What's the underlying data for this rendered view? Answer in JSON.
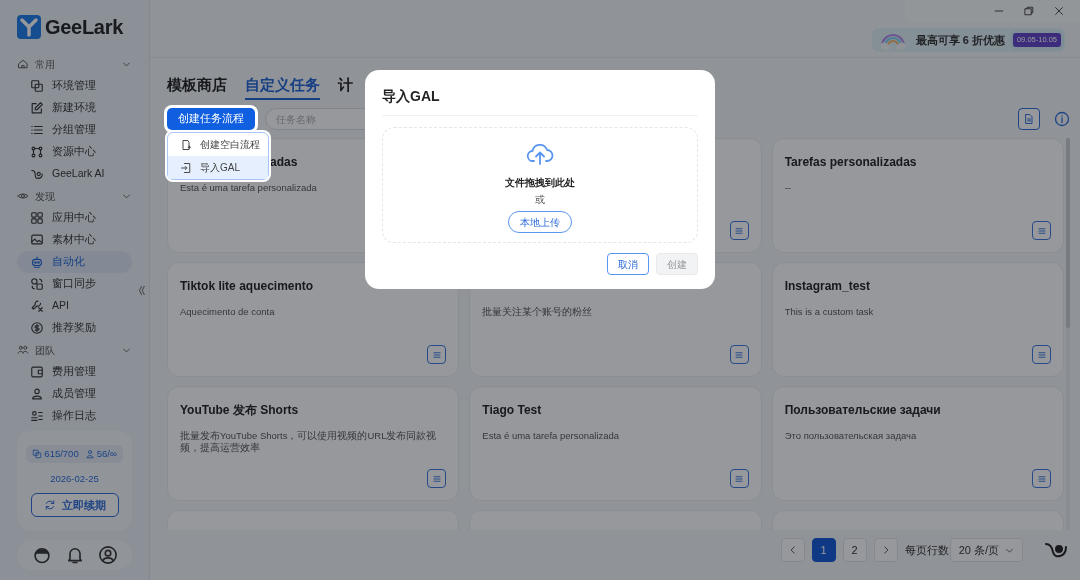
{
  "sidebar": {
    "logo": "GeeLark",
    "groups": [
      {
        "label": "常用",
        "expanded": true,
        "items": [
          {
            "label": "环境管理",
            "selected": false
          },
          {
            "label": "新建环境",
            "selected": false
          },
          {
            "label": "分组管理",
            "selected": false
          },
          {
            "label": "资源中心",
            "selected": false
          },
          {
            "label": "GeeLark AI",
            "selected": false
          }
        ]
      },
      {
        "label": "发现",
        "expanded": true,
        "items": [
          {
            "label": "应用中心",
            "selected": false
          },
          {
            "label": "素材中心",
            "selected": false
          },
          {
            "label": "自动化",
            "selected": true
          },
          {
            "label": "窗口同步",
            "selected": false
          },
          {
            "label": "API",
            "selected": false
          },
          {
            "label": "推荐奖励",
            "selected": false
          }
        ]
      },
      {
        "label": "团队",
        "expanded": true,
        "items": [
          {
            "label": "费用管理",
            "selected": false
          },
          {
            "label": "成员管理",
            "selected": false
          },
          {
            "label": "操作日志",
            "selected": false
          }
        ]
      }
    ],
    "plan": {
      "devices": "615/700",
      "members": "56/∞",
      "expiry": "2026-02-25",
      "renew_button": "立即续期"
    }
  },
  "promo": {
    "text": "最高可享 6 折优惠",
    "dates": "09.05-10.05"
  },
  "tabs": [
    {
      "label": "模板商店",
      "selected": false
    },
    {
      "label": "自定义任务",
      "selected": true
    },
    {
      "label": "计",
      "selected": false
    }
  ],
  "create_button": {
    "label": "创建任务流程",
    "expanded": true
  },
  "create_menu": [
    {
      "label": "创建空白流程",
      "selected": false
    },
    {
      "label": "导入GAL",
      "selected": true
    }
  ],
  "search": {
    "placeholder": "任务名称"
  },
  "cards": [
    {
      "kind": "task",
      "title": "adas",
      "covered": true,
      "description": "Esta é uma tarefa personalizada"
    },
    {
      "kind": "task",
      "details_button": true
    },
    {
      "kind": "task",
      "title": "Tarefas personalizadas",
      "description": "--",
      "details_button": true
    },
    {
      "kind": "task",
      "title": "Tiktok lite aquecimento",
      "description": "Aquecimento de conta",
      "details_button": true
    },
    {
      "kind": "task",
      "description": "批量关注某个账号的粉丝",
      "details_button": true
    },
    {
      "kind": "task",
      "title": "Instagram_test",
      "description": "This is a custom task",
      "details_button": true
    },
    {
      "kind": "task",
      "title": "YouTube 发布 Shorts",
      "description": "批量发布YouTube Shorts，可以使用视频的URL发布同款视频，提高运营效率",
      "details_button": true
    },
    {
      "kind": "task",
      "title": "Tiago Test",
      "description": "Esta é uma tarefa personalizada",
      "details_button": true
    },
    {
      "kind": "task",
      "title": "Пользовательские задачи",
      "description": "Это пользовательская задача",
      "details_button": true
    },
    {
      "kind": "task"
    },
    {
      "kind": "task"
    },
    {
      "kind": "task"
    }
  ],
  "pagination": {
    "pages": [
      {
        "label": "1",
        "selected": true
      },
      {
        "label": "2",
        "selected": false
      }
    ],
    "rows_label": "每页行数",
    "page_size": "20 条/页"
  },
  "dialog": {
    "title": "导入GAL",
    "drop_text": "文件拖拽到此处",
    "or_text": "或",
    "upload_button": "本地上传",
    "cancel_button": "取消",
    "create_button": {
      "label": "创建",
      "disabled": true
    }
  }
}
